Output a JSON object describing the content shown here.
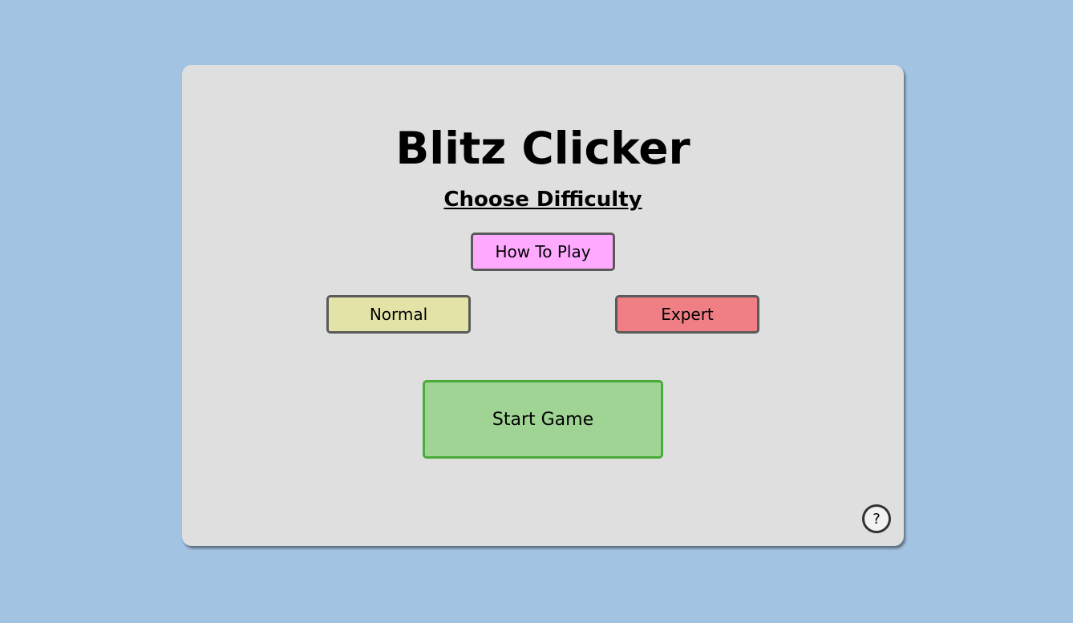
{
  "game": {
    "title": "Blitz Clicker",
    "subtitle": "Choose Difficulty",
    "how_to_play_label": "How To Play",
    "difficulties": [
      {
        "label": "Normal",
        "color": "#e3e3a8"
      },
      {
        "label": "Expert",
        "color": "#ef7f84"
      }
    ],
    "start_label": "Start Game",
    "help_icon_label": "?"
  },
  "colors": {
    "background": "#a3c3e3",
    "panel": "#dfdfdf",
    "how_to_play": "#ffaaff",
    "start": "#9fd494",
    "start_border": "#4aaa3a"
  }
}
